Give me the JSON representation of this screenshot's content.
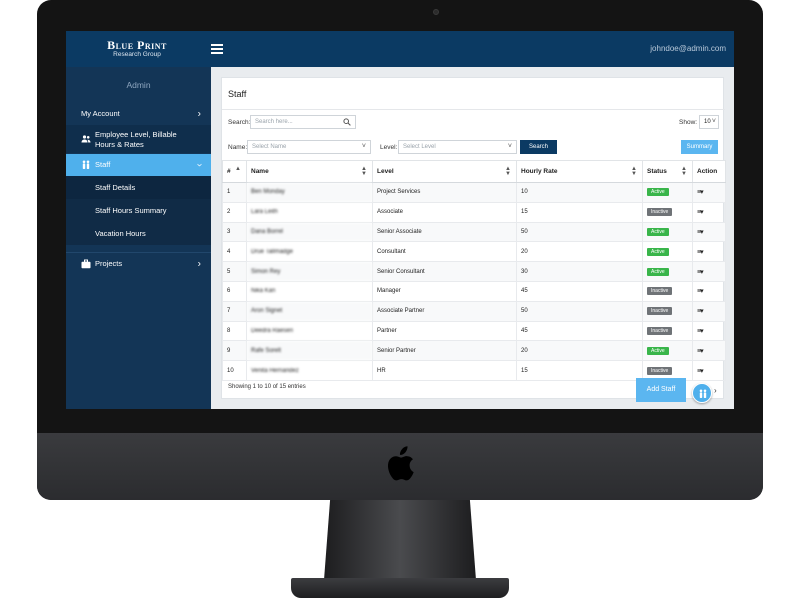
{
  "brand": {
    "title": "Blue Print",
    "subtitle": "Research Group"
  },
  "header": {
    "user_email": "johndoe@admin.com"
  },
  "sidebar": {
    "title": "Admin",
    "items": [
      {
        "label": "My Account"
      },
      {
        "label": "Employee Level, Billable Hours & Rates"
      },
      {
        "label": "Staff"
      },
      {
        "label": "Projects"
      }
    ],
    "staff_sub": [
      {
        "label": "Staff Details"
      },
      {
        "label": "Staff Hours Summary"
      },
      {
        "label": "Vacation Hours"
      }
    ]
  },
  "panel": {
    "title": "Staff",
    "search_label": "Search:",
    "search_placeholder": "Search here...",
    "show_label": "Show:",
    "show_value": "10",
    "name_label": "Name:",
    "name_placeholder": "Select Name",
    "level_label": "Level:",
    "level_placeholder": "Select Level",
    "search_button": "Search",
    "summary_button": "Summary"
  },
  "table": {
    "headers": [
      "#",
      "Name",
      "Level",
      "Hourly Rate",
      "Status",
      "Action"
    ],
    "rows": [
      {
        "num": "1",
        "name": "Ben Monday",
        "level": "Project Services",
        "rate": "10",
        "status": "Active"
      },
      {
        "num": "2",
        "name": "Lara Leith",
        "level": "Associate",
        "rate": "15",
        "status": "Inactive"
      },
      {
        "num": "3",
        "name": "Dana Borrel",
        "level": "Senior Associate",
        "rate": "50",
        "status": "Active"
      },
      {
        "num": "4",
        "name": "Drue Tallmadge",
        "level": "Consultant",
        "rate": "20",
        "status": "Active"
      },
      {
        "num": "5",
        "name": "Simon Rey",
        "level": "Senior Consultant",
        "rate": "30",
        "status": "Active"
      },
      {
        "num": "6",
        "name": "Nika Kan",
        "level": "Manager",
        "rate": "45",
        "status": "Inactive"
      },
      {
        "num": "7",
        "name": "Aron Signet",
        "level": "Associate Partner",
        "rate": "50",
        "status": "Inactive"
      },
      {
        "num": "8",
        "name": "Deedra Raesen",
        "level": "Partner",
        "rate": "45",
        "status": "Inactive"
      },
      {
        "num": "9",
        "name": "Rafe Sorelt",
        "level": "Senior Partner",
        "rate": "20",
        "status": "Active"
      },
      {
        "num": "10",
        "name": "Venita Hernandez",
        "level": "HR",
        "rate": "15",
        "status": "Inactive"
      }
    ]
  },
  "footer": {
    "showing": "Showing 1 to 10 of 15 entries",
    "add_staff": "Add Staff"
  },
  "colors": {
    "topbar": "#0b3a63",
    "sidebar": "#133556",
    "accent": "#4fb0ec",
    "active_badge": "#39b54a",
    "inactive_badge": "#6f7377"
  }
}
